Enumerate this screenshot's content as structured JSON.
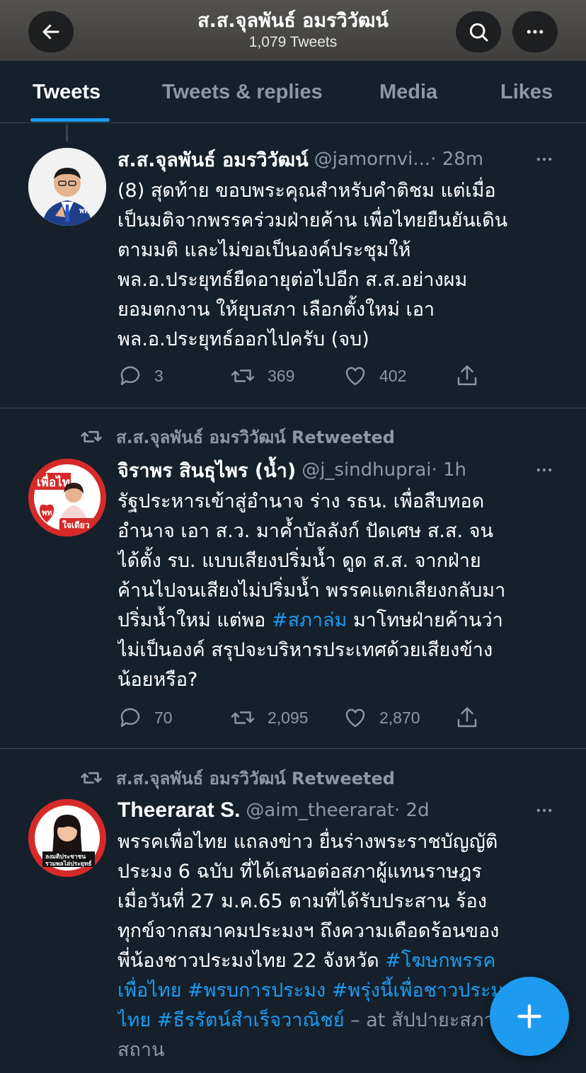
{
  "header": {
    "title": "ส.ส.จุลพันธ์ อมรวิวัฒน์",
    "subtitle": "1,079 Tweets",
    "back_icon": "arrow-left-icon",
    "search_icon": "search-icon",
    "more_icon": "more-horizontal-icon"
  },
  "tabs": [
    "Tweets",
    "Tweets & replies",
    "Media",
    "Likes"
  ],
  "active_tab": "Tweets",
  "accent_color": "#1d9bf0",
  "tweets": [
    {
      "name": "ส.ส.จุลพันธ์ อมรวิวัฒน์",
      "handle": "@jamornvi...",
      "time": "· 28m",
      "lines": [
        "(8) สุดท้าย ขอบพระคุณสำหรับคำติชม แต่เมื่อ",
        "เป็นมติจากพรรคร่วมฝ่ายค้าน เพื่อไทยยืนยันเดิน",
        "ตามมติ และไม่ขอเป็นองค์ประชุมให้",
        "พล.อ.ประยุทธ์ยืดอายุต่อไปอีก ส.ส.อย่างผม",
        "ยอมตกงาน ให้ยุบสภา เลือกตั้งใหม่ เอา",
        "พล.อ.ประยุทธ์ออกไปครับ (จบ)"
      ],
      "replies": "3",
      "retweets": "369",
      "likes": "402"
    },
    {
      "retweeted_by": "ส.ส.จุลพันธ์ อมรวิวัฒน์ Retweeted",
      "name": "จิราพร สินธุไพร (น้ำ)",
      "handle": "@j_sindhuprai",
      "time": "· 1h",
      "avatar_text_top": "เพื่อไทย",
      "avatar_badge": "พท",
      "avatar_text_bottom": "ใจเดียว",
      "lines_a": [
        "รัฐประหารเข้าสู่อำนาจ ร่าง รธน. เพื่อสืบทอด",
        "อำนาจ เอา ส.ว. มาค้ำบัลลังก์ ปัดเศษ ส.ส. จน",
        "ได้ตั้ง รบ. แบบเสียงปริ่มน้ำ ดูด ส.ส. จากฝ่าย",
        "ค้านไปจนเสียงไม่ปริ่มน้ำ พรรคแตกเสียงกลับมา"
      ],
      "line5_pre": "ปริ่มน้ำใหม่ แต่พอ ",
      "line5_tag": "#สภาล่ม",
      "line5_post": " มาโทษฝ่ายค้านว่า",
      "lines_b": [
        "ไม่เป็นองค์ สรุปจะบริหารประเทศด้วยเสียงข้าง",
        "น้อยหรือ?"
      ],
      "replies": "70",
      "retweets": "2,095",
      "likes": "2,870"
    },
    {
      "retweeted_by": "ส.ส.จุลพันธ์ อมรวิวัฒน์ Retweeted",
      "name": "Theerarat S.",
      "handle": "@aim_theerarat",
      "time": "· 2d",
      "avatar_caption_1": "ลงมติประชาชน",
      "avatar_caption_2": "รวมพลไล่ประยุทธ์",
      "lines": [
        "พรรคเพื่อไทย แถลงข่าว ยื่นร่างพระราชบัญญัติ",
        "ประมง 6 ฉบับ ที่ได้เสนอต่อสภาผู้แทนราษฎร",
        "เมื่อวันที่ 27 ม.ค.65 ตามที่ได้รับประสาน ร้อง",
        "ทุกข์จากสมาคมประมงฯ ถึงความเดือดร้อนของ"
      ],
      "line5_pre": "พี่น้องชาวประมงไทย 22 จังหวัด ",
      "line5_tag": "#โฆษกพรรค",
      "line6": "เพื่อไทย #พรบการประมง #พรุ่งนี้เพื่อชาวประมง",
      "line7_tag": "ไทย #ธีรรัตน์สำเร็จวาณิชย์",
      "line7_post": " – at สัปปายะสภา",
      "line8": "สถาน"
    }
  ],
  "fab_icon": "compose-plus-icon"
}
